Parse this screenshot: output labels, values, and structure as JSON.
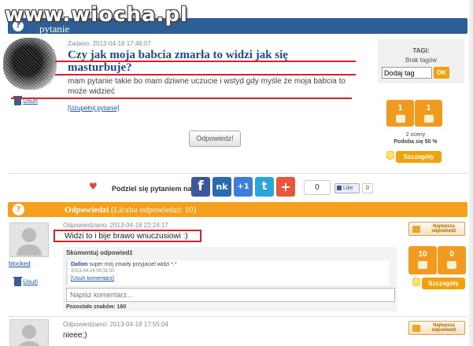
{
  "watermark": "www.wiocha.pl",
  "question_bar": {
    "title": "pytanie",
    "icon": "question-mark-icon"
  },
  "question": {
    "date": "Zadano: 2013-04-18 17:46:07",
    "title": "Czy jak moja babcia zmarła to widzi jak się masturbuje?",
    "body": "mam pytanie takie bo mam dziwne uczucie i wstyd gdy myśle że moja babcia to może widzieć",
    "complete_link": "[Uzupełnij pytanie]",
    "delete_label": "Usuń",
    "answer_button": "Odpowiedz!"
  },
  "tags": {
    "header": "TAGI:",
    "empty": "Brak tagów",
    "input_value": "Dodaj tag",
    "ok": "OK"
  },
  "question_votes": {
    "up": "1",
    "down": "1",
    "ratings": "2 oceny",
    "liked": "Podoba się 50 %",
    "details": "Szczegóły"
  },
  "share": {
    "label": "Podziel się pytaniem na",
    "count": "0",
    "fb_like": "Like",
    "fb_count": "0",
    "buttons": [
      "f",
      "nk",
      "+1",
      "t",
      "+"
    ]
  },
  "answers_bar": {
    "title": "Odpowiedzi",
    "count_label": "(Liczba odpowiedzi: 10)"
  },
  "answer1": {
    "user": "blocked",
    "delete_label": "Usuń",
    "date": "Odpowiedziano: 2013-04-18 22:24:17",
    "text": "Widzi to i bije brawo wnuczusiowi :)",
    "best_label": "Najlepsza odpowiedź",
    "up": "10",
    "down": "0",
    "details": "Szczegóły",
    "comment_header": "Skomentuj odpowiedź",
    "comment": {
      "author": "Dallon",
      "text": "super mój zmarły przyjaciel widzi *.*",
      "date": "2013-04-24 00:32:50",
      "delete": "[Usuń komentarz]"
    },
    "comment_placeholder": "Napisz komentarz...",
    "remaining": "Pozostało znaków: 160"
  },
  "answer2": {
    "date": "Odpowiedziano: 2013-04-18 17:55:04",
    "text": "nieee;)",
    "best_label": "Najlepsza odpowiedź"
  },
  "colors": {
    "blue_bar": "#2c5f95",
    "orange": "#f4a01d",
    "red_underline": "#d6202a"
  }
}
